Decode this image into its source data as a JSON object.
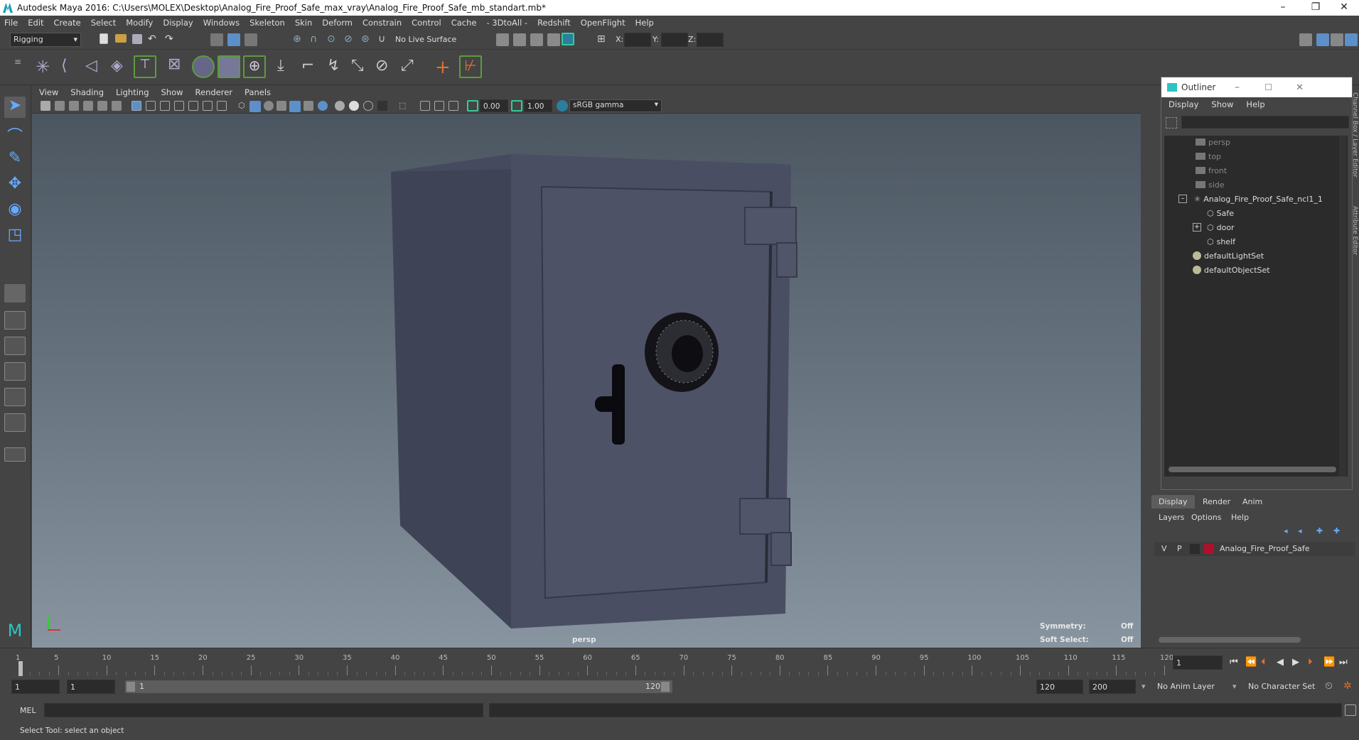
{
  "window": {
    "title": "Autodesk Maya 2016: C:\\Users\\MOLEX\\Desktop\\Analog_Fire_Proof_Safe_max_vray\\Analog_Fire_Proof_Safe_mb_standart.mb*",
    "minimize": "–",
    "maximize": "❐",
    "close": "✕"
  },
  "menubar": [
    "File",
    "Edit",
    "Create",
    "Select",
    "Modify",
    "Display",
    "Windows",
    "Skeleton",
    "Skin",
    "Deform",
    "Constrain",
    "Control",
    "Cache",
    "- 3DtoAll -",
    "Redshift",
    "OpenFlight",
    "Help"
  ],
  "toolbar": {
    "mode": "Rigging",
    "live_surface": "No Live Surface",
    "x_label": "X:",
    "y_label": "Y:",
    "z_label": "Z:"
  },
  "viewport": {
    "menus": [
      "View",
      "Shading",
      "Lighting",
      "Show",
      "Renderer",
      "Panels"
    ],
    "exposure": "0.00",
    "gamma_value": "1.00",
    "color_space": "sRGB gamma",
    "camera_label": "persp",
    "hud": {
      "symmetry_label": "Symmetry:",
      "symmetry_value": "Off",
      "soft_select_label": "Soft Select:",
      "soft_select_value": "Off"
    }
  },
  "outliner": {
    "title": "Outliner",
    "menus": [
      "Display",
      "Show",
      "Help"
    ],
    "items": [
      {
        "label": "persp",
        "dim": true
      },
      {
        "label": "top",
        "dim": true
      },
      {
        "label": "front",
        "dim": true
      },
      {
        "label": "side",
        "dim": true
      },
      {
        "label": "Analog_Fire_Proof_Safe_ncl1_1",
        "dim": false
      },
      {
        "label": "Safe",
        "dim": false
      },
      {
        "label": "door",
        "dim": false
      },
      {
        "label": "shelf",
        "dim": false
      },
      {
        "label": "defaultLightSet",
        "dim": false
      },
      {
        "label": "defaultObjectSet",
        "dim": false
      }
    ]
  },
  "side_tabs": {
    "channel_box": "Channel Box / Layer Editor",
    "attribute_editor": "Attribute Editor"
  },
  "layer_editor": {
    "tabs": [
      "Display",
      "Render",
      "Anim"
    ],
    "menus": [
      "Layers",
      "Options",
      "Help"
    ],
    "layer": {
      "v": "V",
      "p": "P",
      "name": "Analog_Fire_Proof_Safe",
      "color": "#b0102a"
    }
  },
  "timeline": {
    "ticks": [
      1,
      5,
      10,
      15,
      20,
      25,
      30,
      35,
      40,
      45,
      50,
      55,
      60,
      65,
      70,
      75,
      80,
      85,
      90,
      95,
      100,
      105,
      110,
      115,
      120
    ],
    "current_frame": "1"
  },
  "range": {
    "start": "1",
    "playback_start": "1",
    "slider_start": "1",
    "slider_end": "120",
    "playback_end": "120",
    "end": "200",
    "anim_layer": "No Anim Layer",
    "character_set": "No Character Set"
  },
  "command": {
    "language": "MEL"
  },
  "status": {
    "help_line": "Select Tool: select an object"
  },
  "colors": {
    "ui_bg": "#444444",
    "accent": "#5d8fc9",
    "safe_body": "#4a4e62"
  }
}
